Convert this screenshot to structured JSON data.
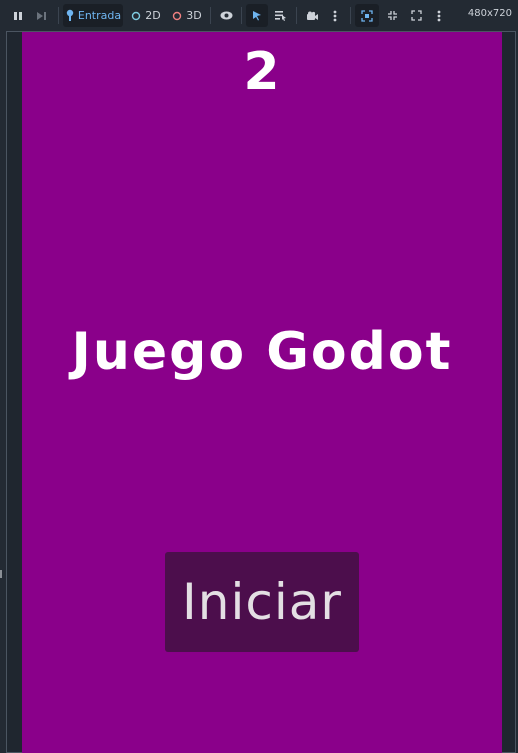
{
  "toolbar": {
    "input_label": "Entrada",
    "mode_2d_label": "2D",
    "mode_3d_label": "3D",
    "resolution": "480x720",
    "icons": [
      "pause-icon",
      "step-icon",
      "input-pointer-icon",
      "circle-2d-icon",
      "circle-3d-icon",
      "eye-icon",
      "select-arrow-icon",
      "list-select-icon",
      "camera-icon",
      "more-vertical-icon",
      "focus-frame-icon",
      "shrink-icon",
      "expand-icon",
      "more-vertical-icon"
    ],
    "colors": {
      "input_active": "#6fb5f0",
      "mode_2d_circle": "#7ecbe0",
      "mode_3d_circle": "#f08080"
    }
  },
  "game": {
    "score": "2",
    "title": "Juego Godot",
    "start_label": "Iniciar",
    "colors": {
      "background": "#8a008a",
      "button": "#4c0e4c",
      "text": "#ffffff"
    }
  }
}
